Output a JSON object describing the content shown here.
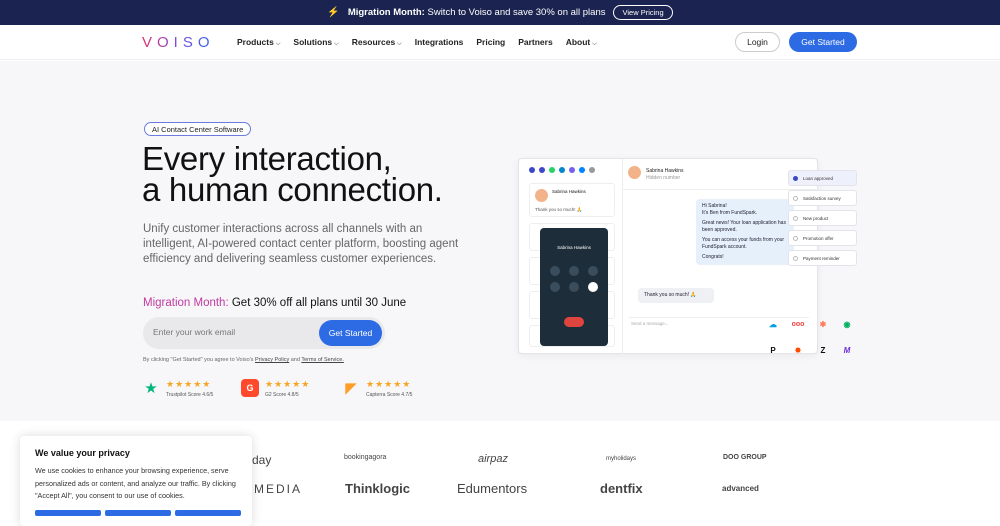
{
  "banner": {
    "title": "Migration Month:",
    "text": "Switch to Voiso and save 30% on all plans",
    "button": "View Pricing"
  },
  "nav": {
    "logo": "VOISO",
    "items": [
      {
        "label": "Products",
        "dropdown": true
      },
      {
        "label": "Solutions",
        "dropdown": true
      },
      {
        "label": "Resources",
        "dropdown": true
      },
      {
        "label": "Integrations",
        "dropdown": false
      },
      {
        "label": "Pricing",
        "dropdown": false
      },
      {
        "label": "Partners",
        "dropdown": false
      },
      {
        "label": "About",
        "dropdown": true
      }
    ],
    "login": "Login",
    "get_started": "Get Started"
  },
  "hero": {
    "badge": "AI Contact Center Software",
    "title_line1": "Every interaction,",
    "title_line2": "a human connection.",
    "subtitle": "Unify customer interactions across all channels with an intelligent, AI-powered contact center platform, boosting agent efficiency and delivering seamless customer experiences.",
    "migration_label": "Migration Month:",
    "migration_text": "Get 30% off all plans until 30 June",
    "email_placeholder": "Enter your work email",
    "cta": "Get Started",
    "legal_prefix": "By clicking \"Get Started\" you agree to Voiso's",
    "privacy_link": "Privacy Policy",
    "legal_and": "and",
    "terms_link": "Terms of Service."
  },
  "ratings": [
    {
      "label": "Trustpilot Score 4.6/5",
      "icon": "trustpilot-icon",
      "stars": "★★★★★"
    },
    {
      "label": "G2 Score 4.8/5",
      "icon": "g2-icon",
      "stars": "★★★★★"
    },
    {
      "label": "Capterra Score 4.7/5",
      "icon": "capterra-icon",
      "stars": "★★★★★"
    }
  ],
  "mockup": {
    "contact_name": "Sabrina Hawkins",
    "contact_sub": "Hidden number",
    "card_name": "Sabrina Hawkins",
    "card_msg": "Thank you so much! 🙏",
    "phone_name": "Sabrina Hawkins",
    "messages": [
      "Hi Sabrina!",
      "It's Ben from FundSpark.",
      "Great news! Your loan application has been approved.",
      "You can access your funds from your FundSpark account.",
      "Congrats!"
    ],
    "reply": "Thank you so much! 🙏",
    "input_placeholder": "Send a message...",
    "ai_items": [
      "Loan approved",
      "Satisfaction survey",
      "New product",
      "Promotion offer",
      "Payment reminder"
    ]
  },
  "privacy": {
    "title": "We value your privacy",
    "text": "We use cookies to enhance your browsing experience, serve personalized ads or content, and analyze our traffic. By clicking \"Accept All\", you consent to our use of cookies."
  },
  "clients": [
    "day",
    "bookingagora",
    "airpaz",
    "myholidays",
    "DOO GROUP",
    "MEDIA",
    "Thinklogic",
    "Edumentors",
    "dentfix",
    "advanced"
  ],
  "colors": {
    "accent": "#2d6be4",
    "banner": "#1b2350",
    "migration": "#c03aa0"
  }
}
